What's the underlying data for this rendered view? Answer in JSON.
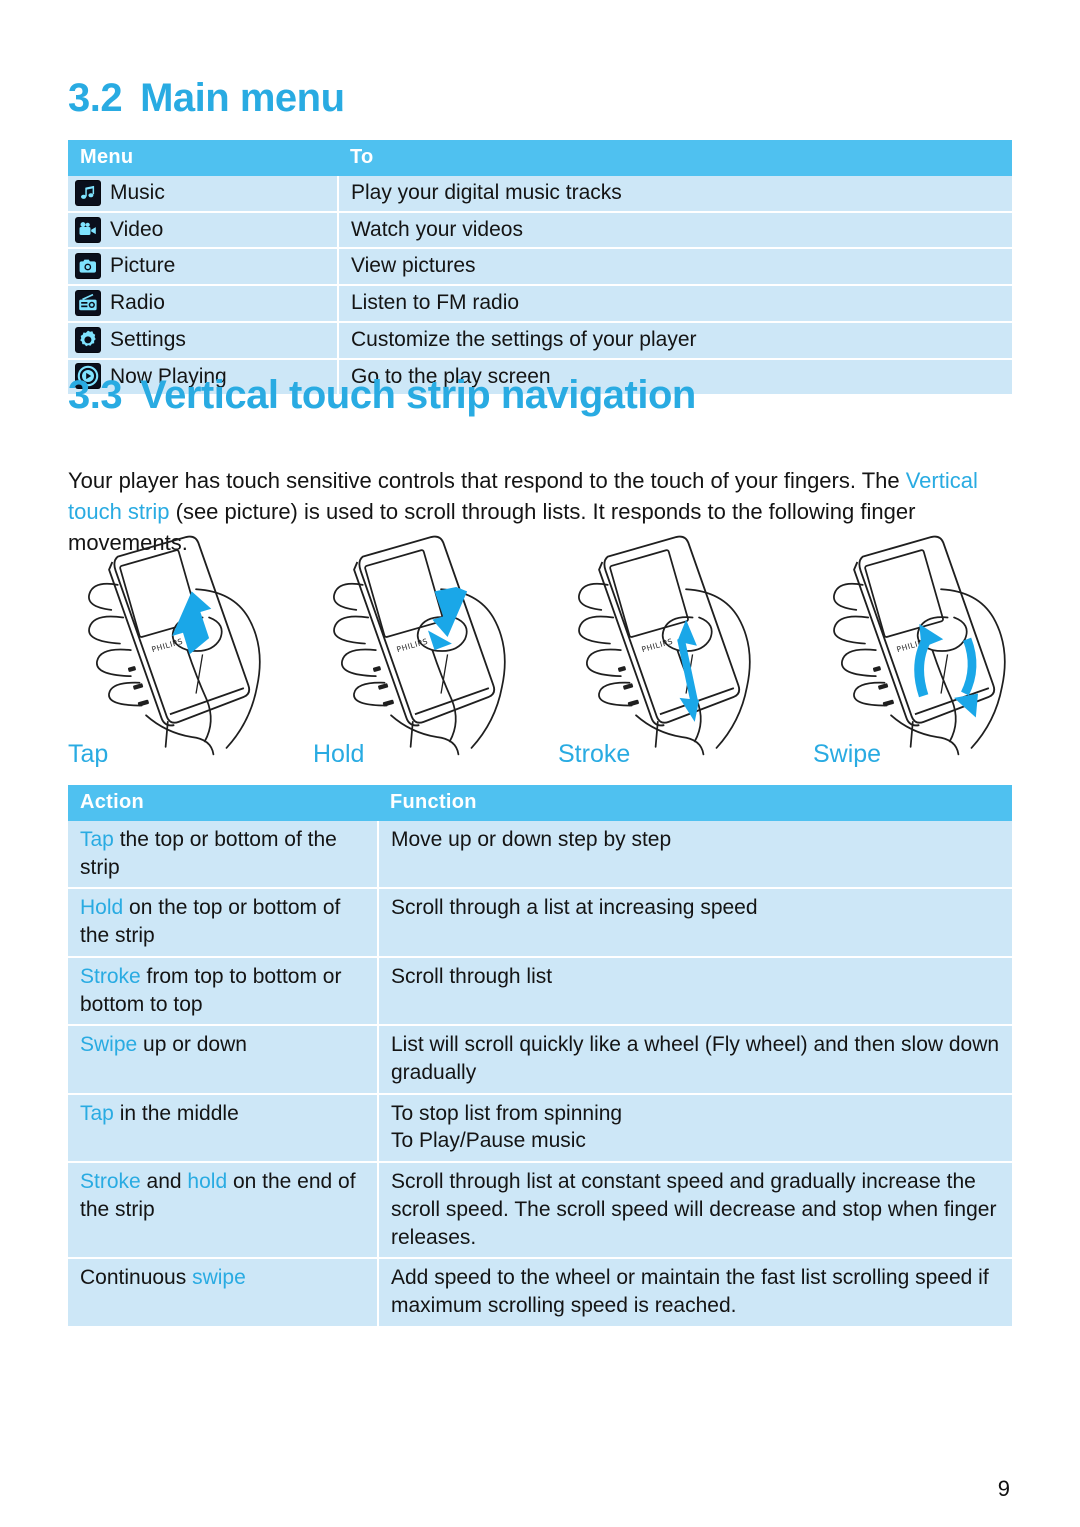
{
  "sections": {
    "main_menu": {
      "number": "3.2",
      "title": "Main menu"
    },
    "vertical_touch": {
      "number": "3.3",
      "title": "Vertical touch strip navigation"
    }
  },
  "body_paragraph": {
    "part1": "Your player has touch sensitive controls that respond to the touch of your fingers. The ",
    "link": "Vertical touch strip",
    "part2": " (see picture) is used to scroll through lists. It responds to the following finger movements."
  },
  "menu_table": {
    "headers": {
      "menu": "Menu",
      "to": "To"
    },
    "rows": [
      {
        "icon": "music-note-icon",
        "label": "Music",
        "to": "Play your digital music tracks"
      },
      {
        "icon": "video-camera-icon",
        "label": "Video",
        "to": "Watch your videos"
      },
      {
        "icon": "camera-icon",
        "label": "Picture",
        "to": "View pictures"
      },
      {
        "icon": "radio-icon",
        "label": "Radio",
        "to": "Listen to FM radio"
      },
      {
        "icon": "gear-icon",
        "label": "Settings",
        "to": "Customize the settings of your player"
      },
      {
        "icon": "play-circle-icon",
        "label": "Now Playing",
        "to": "Go to the play screen"
      }
    ]
  },
  "figures": [
    {
      "name": "tap",
      "label": "Tap",
      "arrow": "single-arrow-up"
    },
    {
      "name": "hold",
      "label": "Hold",
      "arrow": "single-arrow-down"
    },
    {
      "name": "stroke",
      "label": "Stroke",
      "arrow": "double-arrow-vertical"
    },
    {
      "name": "swipe",
      "label": "Swipe",
      "arrow": "curved-arrows-up-down"
    }
  ],
  "action_table": {
    "headers": {
      "action": "Action",
      "function": "Function"
    },
    "rows": [
      {
        "action_parts": [
          {
            "text": "Tap",
            "highlight": true
          },
          {
            "text": " the top or bottom of the strip",
            "highlight": false
          }
        ],
        "function": "Move up or down step by step"
      },
      {
        "action_parts": [
          {
            "text": "Hold",
            "highlight": true
          },
          {
            "text": " on the top or bottom of the strip",
            "highlight": false
          }
        ],
        "function": "Scroll through a list at increasing speed"
      },
      {
        "action_parts": [
          {
            "text": "Stroke",
            "highlight": true
          },
          {
            "text": " from top to bottom or bottom to top",
            "highlight": false
          }
        ],
        "function": "Scroll through list"
      },
      {
        "action_parts": [
          {
            "text": "Swipe",
            "highlight": true
          },
          {
            "text": " up or down",
            "highlight": false
          }
        ],
        "function": "List will scroll quickly like a wheel (Fly wheel) and then slow down gradually"
      },
      {
        "action_parts": [
          {
            "text": "Tap",
            "highlight": true
          },
          {
            "text": " in the middle",
            "highlight": false
          }
        ],
        "function": "To stop list from spinning\nTo Play/Pause music"
      },
      {
        "action_parts": [
          {
            "text": "Stroke",
            "highlight": true
          },
          {
            "text": " and ",
            "highlight": false
          },
          {
            "text": "hold",
            "highlight": true
          },
          {
            "text": " on the end of the strip",
            "highlight": false
          }
        ],
        "function": "Scroll through list at constant speed and gradually increase the scroll speed. The scroll speed will decrease and stop when finger releases."
      },
      {
        "action_parts": [
          {
            "text": "Continuous ",
            "highlight": false
          },
          {
            "text": "swipe",
            "highlight": true
          }
        ],
        "function": "Add speed to the wheel or maintain the fast list scrolling speed if maximum scrolling speed is reached."
      }
    ]
  },
  "device_label": "PHILIPS",
  "page_number": "9",
  "colors": {
    "accent": "#29ABE2",
    "table_header": "#4FC1F0",
    "table_row": "#CDE7F7",
    "arrow": "#1AA7E8",
    "text": "#141414"
  }
}
